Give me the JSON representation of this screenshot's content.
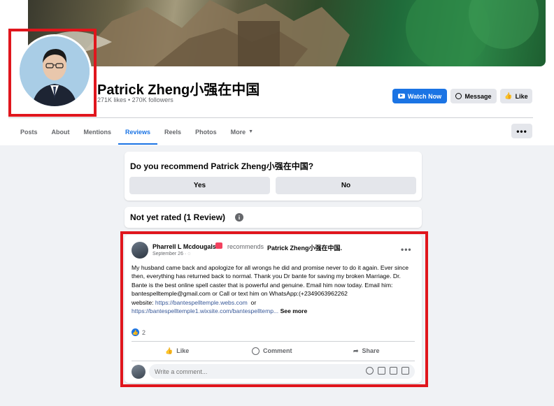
{
  "page": {
    "name": "Patrick Zheng小强在中国",
    "stats": "271K likes • 270K followers"
  },
  "actions": {
    "watch_now": "Watch Now",
    "message": "Message",
    "like": "Like"
  },
  "tabs": [
    "Posts",
    "About",
    "Mentions",
    "Reviews",
    "Reels",
    "Photos",
    "More"
  ],
  "active_tab": "Reviews",
  "more_dots": "•••",
  "recommend": {
    "question": "Do you recommend Patrick Zheng小强在中国?",
    "yes": "Yes",
    "no": "No"
  },
  "rating": {
    "title": "Not yet rated (1 Review)",
    "info_icon": "i"
  },
  "review": {
    "author": "Pharrell L Mcdougals",
    "recommends": "recommends",
    "target": "Patrick Zheng小强在中国.",
    "date": "September 26 · ◌",
    "menu": "•••",
    "body_text": "My husband came back and apologize for all wrongs he did and promise never to do it again. Ever since then, everything has returned back to normal. Thank you Dr bante  for saving my broken Marriage. Dr. Bante is the best online spell caster that is powerful and genuine. Email him now today. Email him: bantespelltemple@gmail.com or Call or text him on WhatsApp:(+2349063962262",
    "website_label": "website:",
    "link1": "https://bantespelltemple.webs.com",
    "or_text": "or",
    "link2": "https://bantespelltemple1.wixsite.com/bantespelltemp...",
    "see_more": "See more",
    "reaction_count": "2",
    "like_label": "Like",
    "comment_label": "Comment",
    "share_label": "Share",
    "comment_placeholder": "Write a comment..."
  },
  "colors": {
    "accent": "#1b74e4",
    "highlight_border": "#e0161d",
    "background": "#f0f2f5"
  }
}
